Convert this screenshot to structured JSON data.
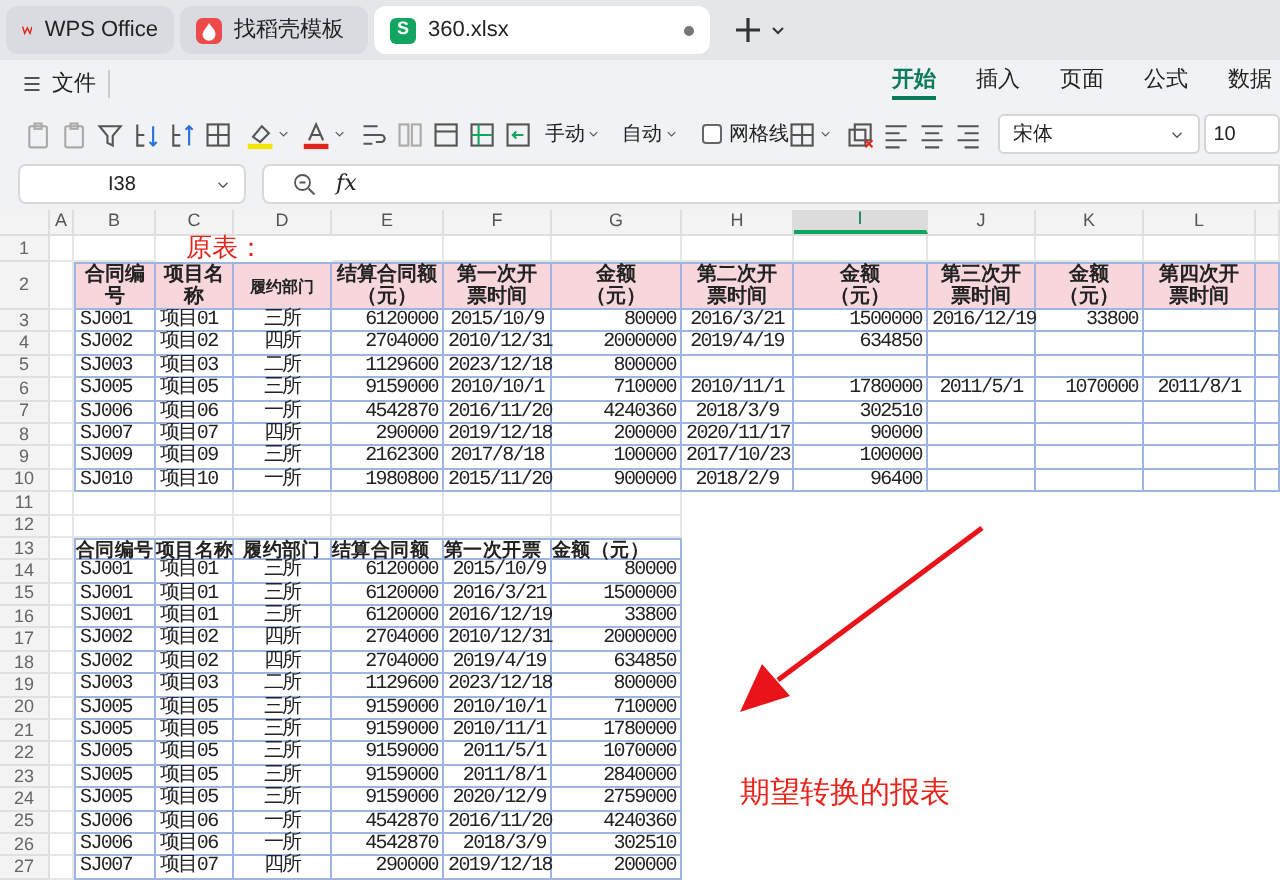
{
  "tabs": [
    {
      "title": "WPS Office",
      "selected": false,
      "kind": "wps"
    },
    {
      "title": "找稻壳模板",
      "selected": false,
      "kind": "template"
    },
    {
      "title": "360.xlsx",
      "selected": true,
      "kind": "sheet",
      "badge": "S"
    }
  ],
  "menu_button": "文件",
  "ribbon_tabs": [
    {
      "label": "开始",
      "selected": true
    },
    {
      "label": "插入",
      "selected": false
    },
    {
      "label": "页面",
      "selected": false
    },
    {
      "label": "公式",
      "selected": false
    },
    {
      "label": "数据",
      "selected": false
    }
  ],
  "toolbar": {
    "row_height": "手动",
    "column_width": "自动",
    "gridlines": {
      "label": "网格线",
      "checked": false
    },
    "font": "宋体",
    "font_size": "10"
  },
  "formula_bar": {
    "name_box": "I38",
    "function_label": "fx"
  },
  "columns": [
    {
      "label": "A",
      "selected": false
    },
    {
      "label": "B",
      "selected": false
    },
    {
      "label": "C",
      "selected": false
    },
    {
      "label": "D",
      "selected": false
    },
    {
      "label": "E",
      "selected": false
    },
    {
      "label": "F",
      "selected": false
    },
    {
      "label": "G",
      "selected": false
    },
    {
      "label": "H",
      "selected": false
    },
    {
      "label": "I",
      "selected": true
    },
    {
      "label": "J",
      "selected": false
    },
    {
      "label": "K",
      "selected": false
    },
    {
      "label": "L",
      "selected": false
    }
  ],
  "row_numbers": [
    "1",
    "2",
    "3",
    "4",
    "5",
    "6",
    "7",
    "8",
    "9",
    "10",
    "11",
    "12",
    "13",
    "14",
    "15",
    "16",
    "17",
    "18",
    "19",
    "20",
    "21",
    "22",
    "23",
    "24",
    "25",
    "26",
    "27"
  ],
  "note": "原表：",
  "original_table": {
    "header": [
      "合同编号",
      "项目名称",
      "履约部门",
      "结算合同额（元）",
      "第一次开票时间",
      "金额（元）",
      "第二次开票时间",
      "金额（元）",
      "第三次开票时间",
      "金额（元）",
      "第四次开票时间"
    ],
    "rows": [
      [
        "SJ001",
        "项目01",
        "三所",
        "6120000",
        "2015/10/9",
        "80000",
        "2016/3/21",
        "1500000",
        "2016/12/19",
        "33800"
      ],
      [
        "SJ002",
        "项目02",
        "四所",
        "2704000",
        "2010/12/31",
        "2000000",
        "2019/4/19",
        "634850"
      ],
      [
        "SJ003",
        "项目03",
        "二所",
        "1129600",
        "2023/12/18",
        "800000"
      ],
      [
        "SJ005",
        "项目05",
        "三所",
        "9159000",
        "2010/10/1",
        "710000",
        "2010/11/1",
        "1780000",
        "2011/5/1",
        "1070000",
        "2011/8/1"
      ],
      [
        "SJ006",
        "项目06",
        "一所",
        "4542870",
        "2016/11/20",
        "4240360",
        "2018/3/9",
        "302510"
      ],
      [
        "SJ007",
        "项目07",
        "四所",
        "290000",
        "2019/12/18",
        "200000",
        "2020/11/17",
        "90000"
      ],
      [
        "SJ009",
        "项目09",
        "三所",
        "2162300",
        "2017/8/18",
        "100000",
        "2017/10/23",
        "100000"
      ],
      [
        "SJ010",
        "项目10",
        "一所",
        "1980800",
        "2015/11/20",
        "900000",
        "2018/2/9",
        "96400"
      ]
    ]
  },
  "result_table": {
    "header": [
      "合同编号",
      "项目名称",
      "履约部门",
      "结算合同额",
      "第一次开票",
      "金额（元）"
    ],
    "rows": [
      [
        "SJ001",
        "项目01",
        "三所",
        "6120000",
        "2015/10/9",
        "80000"
      ],
      [
        "SJ001",
        "项目01",
        "三所",
        "6120000",
        "2016/3/21",
        "1500000"
      ],
      [
        "SJ001",
        "项目01",
        "三所",
        "6120000",
        "2016/12/19",
        "33800"
      ],
      [
        "SJ002",
        "项目02",
        "四所",
        "2704000",
        "2010/12/31",
        "2000000"
      ],
      [
        "SJ002",
        "项目02",
        "四所",
        "2704000",
        "2019/4/19",
        "634850"
      ],
      [
        "SJ003",
        "项目03",
        "二所",
        "1129600",
        "2023/12/18",
        "800000"
      ],
      [
        "SJ005",
        "项目05",
        "三所",
        "9159000",
        "2010/10/1",
        "710000"
      ],
      [
        "SJ005",
        "项目05",
        "三所",
        "9159000",
        "2010/11/1",
        "1780000"
      ],
      [
        "SJ005",
        "项目05",
        "三所",
        "9159000",
        "2011/5/1",
        "1070000"
      ],
      [
        "SJ005",
        "项目05",
        "三所",
        "9159000",
        "2011/8/1",
        "2840000"
      ],
      [
        "SJ005",
        "项目05",
        "三所",
        "9159000",
        "2020/12/9",
        "2759000"
      ],
      [
        "SJ006",
        "项目06",
        "一所",
        "4542870",
        "2016/11/20",
        "4240360"
      ],
      [
        "SJ006",
        "项目06",
        "一所",
        "4542870",
        "2018/3/9",
        "302510"
      ],
      [
        "SJ007",
        "项目07",
        "四所",
        "290000",
        "2019/12/18",
        "200000"
      ]
    ]
  },
  "annotation": "期望转换的报表"
}
